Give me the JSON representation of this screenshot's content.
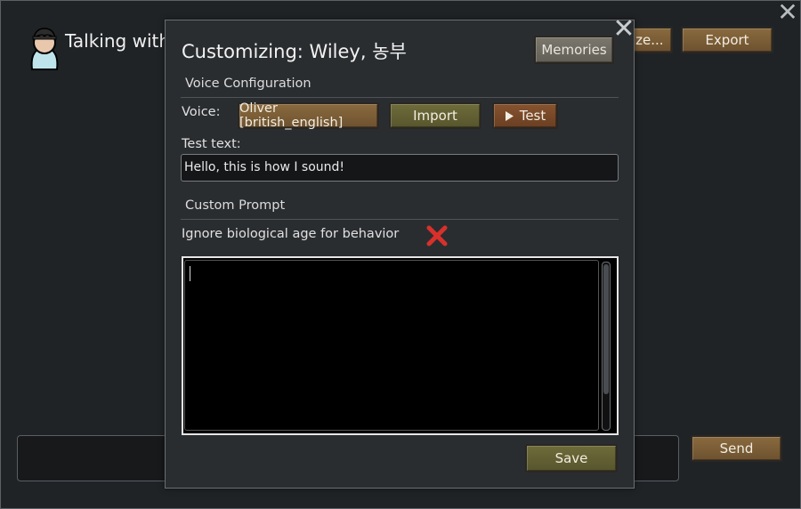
{
  "background_window": {
    "title": "Talking with",
    "close_glyph": "✕",
    "buttons": {
      "customize": "ize...",
      "export": "Export",
      "send": "Send"
    },
    "message_input": {
      "value": "",
      "placeholder": ""
    }
  },
  "modal": {
    "title": "Customizing: Wiley, 농부",
    "close_glyph": "✕",
    "memories_button": "Memories",
    "voice_section": {
      "heading": "Voice Configuration",
      "voice_label": "Voice:",
      "voice_selected": "Oliver [british_english]",
      "import_button": "Import",
      "test_button": "Test",
      "test_icon": "play-icon",
      "test_text_label": "Test text:",
      "test_text_value": "Hello, this is how I sound!"
    },
    "prompt_section": {
      "heading": "Custom Prompt",
      "ignore_age_label": "Ignore biological age for behavior",
      "ignore_age_checked": false,
      "checkbox_icon": "red-x-icon",
      "prompt_value": ""
    },
    "save_button": "Save"
  },
  "colors": {
    "background": "#202326",
    "modal_bg": "#2a2d30",
    "button_brown": "#7a5d36",
    "button_olive": "#626033",
    "button_grey": "#6f6b62",
    "button_rust": "#7a4a29",
    "cross_red": "#d8302b"
  }
}
